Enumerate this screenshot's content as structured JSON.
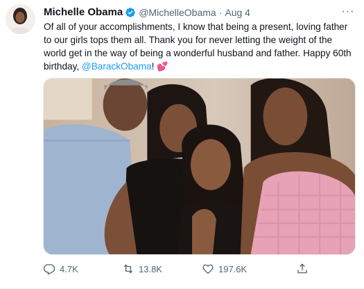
{
  "tweet": {
    "author_name": "Michelle Obama",
    "handle": "@MichelleObama",
    "separator": "·",
    "date": "Aug 4",
    "more_label": "···",
    "text_before": "Of all of your accomplishments, I know that being a present, loving father to our girls tops them all. Thank you for never letting the weight of the world get in the way of being a wonderful husband and father. Happy 60th birthday, ",
    "mention": "@BarackObama",
    "text_after": "! ",
    "emoji": "💕",
    "image_alt": "Family photo"
  },
  "actions": {
    "reply_count": "4.7K",
    "retweet_count": "13.8K",
    "like_count": "197.6K"
  },
  "colors": {
    "accent": "#1d9bf0",
    "muted": "#536471",
    "text": "#0f1419"
  },
  "icons": {
    "verified": "verified-badge-icon",
    "more": "more-icon",
    "reply": "reply-icon",
    "retweet": "retweet-icon",
    "like": "like-icon",
    "share": "share-icon"
  }
}
